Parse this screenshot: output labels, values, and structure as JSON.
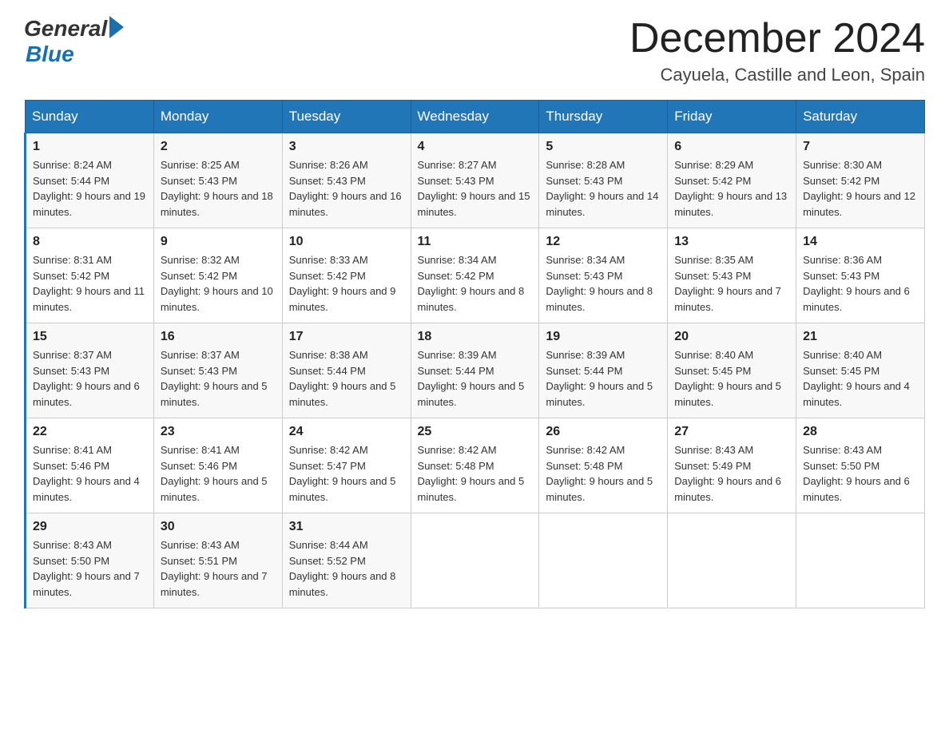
{
  "header": {
    "logo_text1": "General",
    "logo_text2": "Blue",
    "month_title": "December 2024",
    "subtitle": "Cayuela, Castille and Leon, Spain"
  },
  "days_of_week": [
    "Sunday",
    "Monday",
    "Tuesday",
    "Wednesday",
    "Thursday",
    "Friday",
    "Saturday"
  ],
  "weeks": [
    [
      {
        "day": "1",
        "sunrise": "8:24 AM",
        "sunset": "5:44 PM",
        "daylight": "9 hours and 19 minutes."
      },
      {
        "day": "2",
        "sunrise": "8:25 AM",
        "sunset": "5:43 PM",
        "daylight": "9 hours and 18 minutes."
      },
      {
        "day": "3",
        "sunrise": "8:26 AM",
        "sunset": "5:43 PM",
        "daylight": "9 hours and 16 minutes."
      },
      {
        "day": "4",
        "sunrise": "8:27 AM",
        "sunset": "5:43 PM",
        "daylight": "9 hours and 15 minutes."
      },
      {
        "day": "5",
        "sunrise": "8:28 AM",
        "sunset": "5:43 PM",
        "daylight": "9 hours and 14 minutes."
      },
      {
        "day": "6",
        "sunrise": "8:29 AM",
        "sunset": "5:42 PM",
        "daylight": "9 hours and 13 minutes."
      },
      {
        "day": "7",
        "sunrise": "8:30 AM",
        "sunset": "5:42 PM",
        "daylight": "9 hours and 12 minutes."
      }
    ],
    [
      {
        "day": "8",
        "sunrise": "8:31 AM",
        "sunset": "5:42 PM",
        "daylight": "9 hours and 11 minutes."
      },
      {
        "day": "9",
        "sunrise": "8:32 AM",
        "sunset": "5:42 PM",
        "daylight": "9 hours and 10 minutes."
      },
      {
        "day": "10",
        "sunrise": "8:33 AM",
        "sunset": "5:42 PM",
        "daylight": "9 hours and 9 minutes."
      },
      {
        "day": "11",
        "sunrise": "8:34 AM",
        "sunset": "5:42 PM",
        "daylight": "9 hours and 8 minutes."
      },
      {
        "day": "12",
        "sunrise": "8:34 AM",
        "sunset": "5:43 PM",
        "daylight": "9 hours and 8 minutes."
      },
      {
        "day": "13",
        "sunrise": "8:35 AM",
        "sunset": "5:43 PM",
        "daylight": "9 hours and 7 minutes."
      },
      {
        "day": "14",
        "sunrise": "8:36 AM",
        "sunset": "5:43 PM",
        "daylight": "9 hours and 6 minutes."
      }
    ],
    [
      {
        "day": "15",
        "sunrise": "8:37 AM",
        "sunset": "5:43 PM",
        "daylight": "9 hours and 6 minutes."
      },
      {
        "day": "16",
        "sunrise": "8:37 AM",
        "sunset": "5:43 PM",
        "daylight": "9 hours and 5 minutes."
      },
      {
        "day": "17",
        "sunrise": "8:38 AM",
        "sunset": "5:44 PM",
        "daylight": "9 hours and 5 minutes."
      },
      {
        "day": "18",
        "sunrise": "8:39 AM",
        "sunset": "5:44 PM",
        "daylight": "9 hours and 5 minutes."
      },
      {
        "day": "19",
        "sunrise": "8:39 AM",
        "sunset": "5:44 PM",
        "daylight": "9 hours and 5 minutes."
      },
      {
        "day": "20",
        "sunrise": "8:40 AM",
        "sunset": "5:45 PM",
        "daylight": "9 hours and 5 minutes."
      },
      {
        "day": "21",
        "sunrise": "8:40 AM",
        "sunset": "5:45 PM",
        "daylight": "9 hours and 4 minutes."
      }
    ],
    [
      {
        "day": "22",
        "sunrise": "8:41 AM",
        "sunset": "5:46 PM",
        "daylight": "9 hours and 4 minutes."
      },
      {
        "day": "23",
        "sunrise": "8:41 AM",
        "sunset": "5:46 PM",
        "daylight": "9 hours and 5 minutes."
      },
      {
        "day": "24",
        "sunrise": "8:42 AM",
        "sunset": "5:47 PM",
        "daylight": "9 hours and 5 minutes."
      },
      {
        "day": "25",
        "sunrise": "8:42 AM",
        "sunset": "5:48 PM",
        "daylight": "9 hours and 5 minutes."
      },
      {
        "day": "26",
        "sunrise": "8:42 AM",
        "sunset": "5:48 PM",
        "daylight": "9 hours and 5 minutes."
      },
      {
        "day": "27",
        "sunrise": "8:43 AM",
        "sunset": "5:49 PM",
        "daylight": "9 hours and 6 minutes."
      },
      {
        "day": "28",
        "sunrise": "8:43 AM",
        "sunset": "5:50 PM",
        "daylight": "9 hours and 6 minutes."
      }
    ],
    [
      {
        "day": "29",
        "sunrise": "8:43 AM",
        "sunset": "5:50 PM",
        "daylight": "9 hours and 7 minutes."
      },
      {
        "day": "30",
        "sunrise": "8:43 AM",
        "sunset": "5:51 PM",
        "daylight": "9 hours and 7 minutes."
      },
      {
        "day": "31",
        "sunrise": "8:44 AM",
        "sunset": "5:52 PM",
        "daylight": "9 hours and 8 minutes."
      },
      null,
      null,
      null,
      null
    ]
  ]
}
